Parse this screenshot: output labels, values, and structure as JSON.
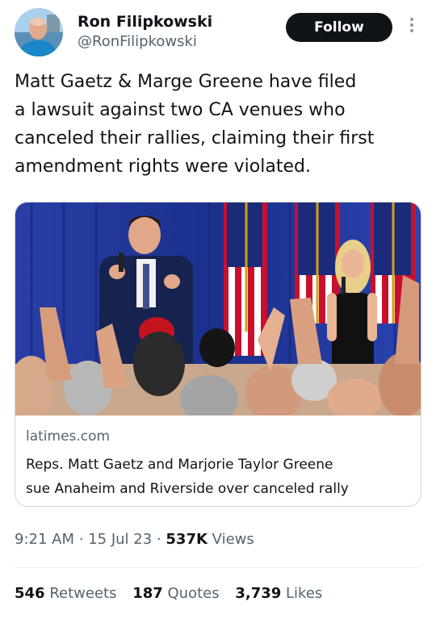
{
  "author": {
    "display_name": "Ron Filipkowski",
    "handle": "@RonFilipkowski"
  },
  "follow_label": "Follow",
  "tweet": {
    "text": "Matt Gaetz & Marge Greene have filed\na lawsuit against two CA venues who\ncanceled their rallies, claiming their first\namendment rights were violated."
  },
  "link_card": {
    "domain": "latimes.com",
    "title": "Reps. Matt Gaetz and Marjorie Taylor Greene\nsue Anaheim and Riverside over canceled rally"
  },
  "meta": {
    "time": "9:21 AM",
    "sep1": "·",
    "date": "15 Jul 23",
    "sep2": "·",
    "views_count": "537K",
    "views_label": "Views"
  },
  "stats": {
    "retweets_count": "546",
    "retweets_label": "Retweets",
    "quotes_count": "187",
    "quotes_label": "Quotes",
    "likes_count": "3,739",
    "likes_label": "Likes"
  },
  "colors": {
    "text": "#0f1419",
    "secondary": "#536471",
    "border": "#cfd9de",
    "stage_curtain": "#1f3a9e"
  }
}
